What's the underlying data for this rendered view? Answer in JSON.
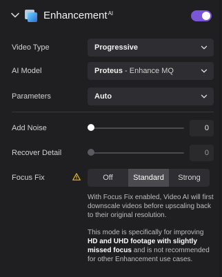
{
  "header": {
    "title": "Enhancement",
    "title_sup": "AI",
    "toggle_on": true
  },
  "video_type": {
    "label": "Video Type",
    "value": "Progressive"
  },
  "ai_model": {
    "label": "AI Model",
    "value": "Proteus",
    "value_sub": " - Enhance MQ"
  },
  "parameters": {
    "label": "Parameters",
    "value": "Auto"
  },
  "add_noise": {
    "label": "Add Noise",
    "value": "0"
  },
  "recover_detail": {
    "label": "Recover Detail",
    "value": "0"
  },
  "focus_fix": {
    "label": "Focus Fix",
    "options": [
      "Off",
      "Standard",
      "Strong"
    ],
    "selected": "Standard"
  },
  "help": {
    "p1": "With Focus Fix enabled, Video AI will first downscale videos before upscaling back to their original resolution.",
    "p2_a": "This mode is specifically for improving ",
    "p2_b": "HD and UHD footage with slightly missed focus",
    "p2_c": " and is not recommended for other Enhancement use cases."
  },
  "colors": {
    "accent": "#7a54d9",
    "background": "#1f1f21",
    "warning": "#e8c21b"
  }
}
